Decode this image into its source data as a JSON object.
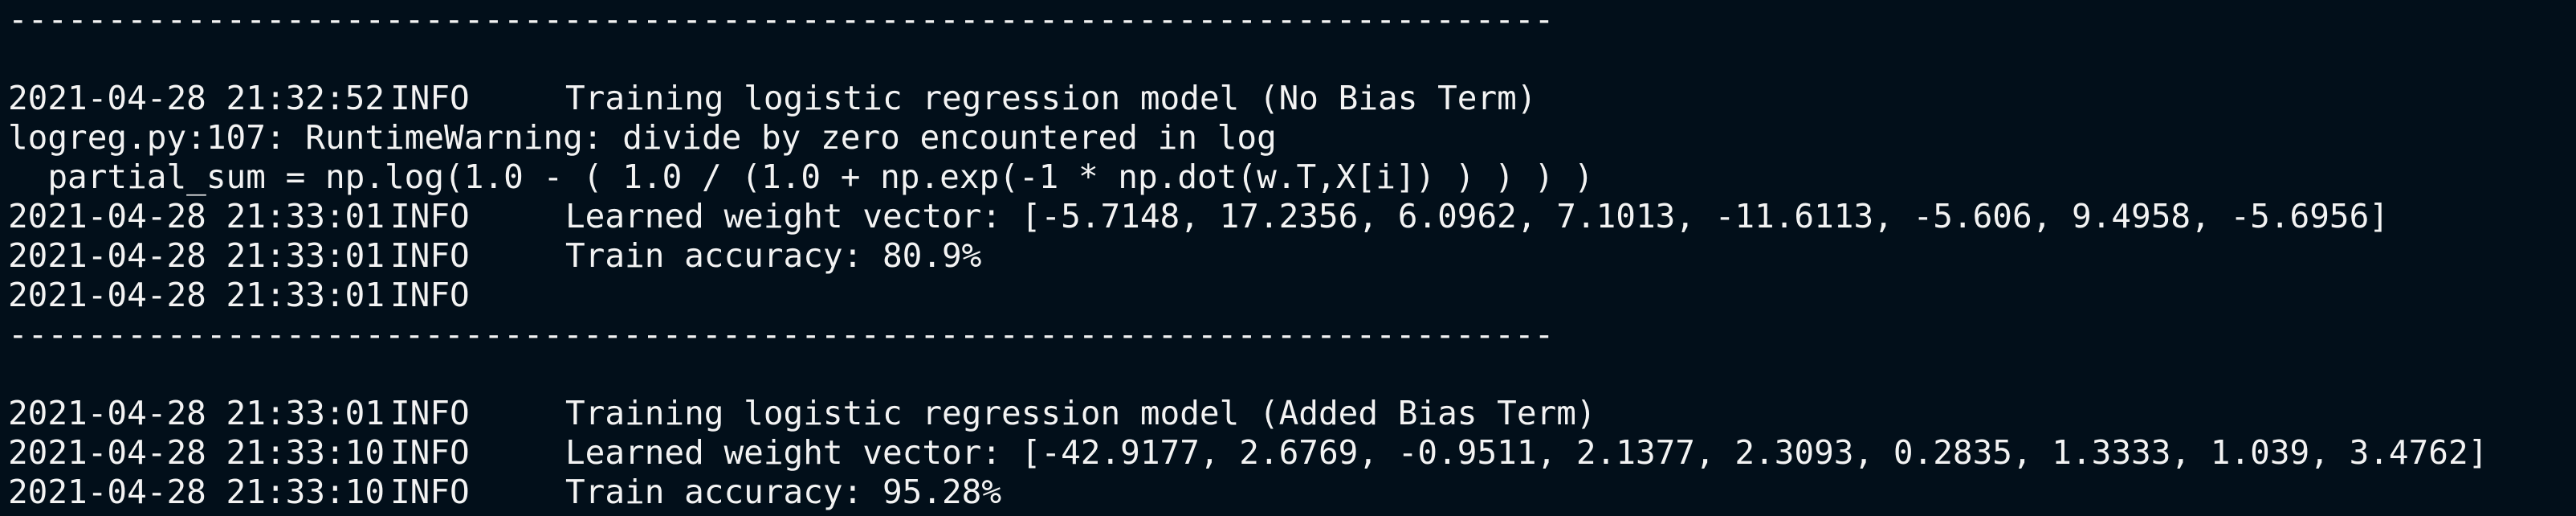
{
  "terminal": {
    "colors": {
      "background": "#020f1a",
      "text": "#f3f3f3"
    },
    "lines": [
      {
        "text": "------------------------------------------------------------------------------"
      },
      {
        "text": ""
      },
      {
        "timestamp": "2021-04-28 21:32:52",
        "level": "INFO",
        "message": "Training logistic regression model (No Bias Term)"
      },
      {
        "text": "logreg.py:107: RuntimeWarning: divide by zero encountered in log"
      },
      {
        "text": "  partial_sum = np.log(1.0 - ( 1.0 / (1.0 + np.exp(-1 * np.dot(w.T,X[i]) ) ) ) )"
      },
      {
        "timestamp": "2021-04-28 21:33:01",
        "level": "INFO",
        "message": "Learned weight vector: [-5.7148, 17.2356, 6.0962, 7.1013, -11.6113, -5.606, 9.4958, -5.6956]"
      },
      {
        "timestamp": "2021-04-28 21:33:01",
        "level": "INFO",
        "message": "Train accuracy: 80.9%"
      },
      {
        "timestamp": "2021-04-28 21:33:01",
        "level": "INFO",
        "message": ""
      },
      {
        "text": "------------------------------------------------------------------------------"
      },
      {
        "text": ""
      },
      {
        "timestamp": "2021-04-28 21:33:01",
        "level": "INFO",
        "message": "Training logistic regression model (Added Bias Term)"
      },
      {
        "timestamp": "2021-04-28 21:33:10",
        "level": "INFO",
        "message": "Learned weight vector: [-42.9177, 2.6769, -0.9511, 2.1377, 2.3093, 0.2835, 1.3333, 1.039, 3.4762]"
      },
      {
        "timestamp": "2021-04-28 21:33:10",
        "level": "INFO",
        "message": "Train accuracy: 95.28%"
      }
    ]
  }
}
